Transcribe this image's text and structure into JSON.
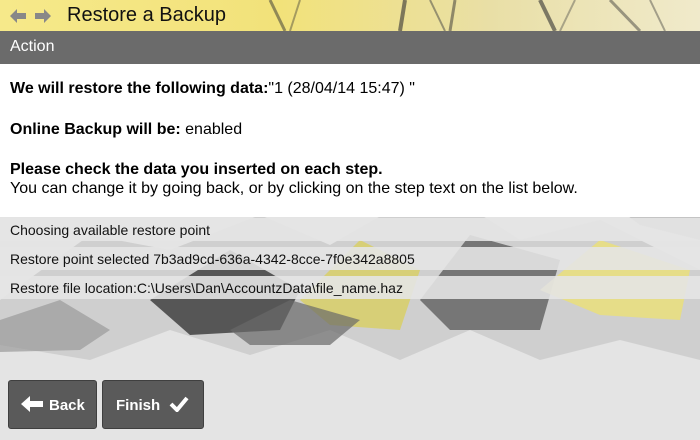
{
  "window": {
    "title": "Restore a Backup",
    "icons": [
      "back-arrow-icon",
      "forward-arrow-icon"
    ]
  },
  "section": {
    "header": "Action"
  },
  "summary": {
    "restore_label": "We will restore the following data:",
    "restore_value": "\"1 (28/04/14 15:47) \"",
    "online_label": "Online Backup will be:",
    "online_value": " enabled",
    "check_heading": "Please check the data you inserted on each step.",
    "check_hint": "You can change it by going back, or by clicking on the step text on the list below."
  },
  "steps": [
    {
      "label": "Choosing available restore point"
    },
    {
      "label": "Restore point selected 7b3ad9cd-636a-4342-8cce-7f0e342a8805"
    },
    {
      "label": "Restore file location:C:\\Users\\Dan\\AccountzData\\file_name.haz"
    }
  ],
  "buttons": {
    "back_label": "Back",
    "finish_label": "Finish",
    "back_icon": "left-arrow-icon",
    "finish_icon": "checkmark-icon"
  },
  "colors": {
    "title_bar": "#f2e27a",
    "header_bg": "#6b6b6b",
    "button_bg": "#5a5a5a",
    "accent_yellow": "#efe06a"
  }
}
